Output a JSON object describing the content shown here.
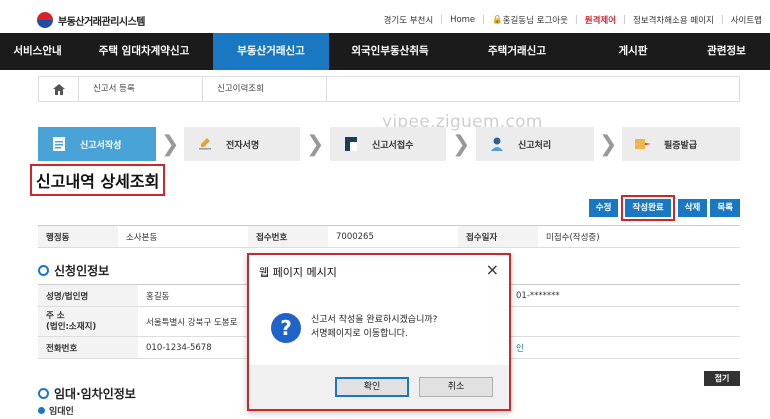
{
  "site": {
    "name": "부동산거래관리시스템"
  },
  "util_links": [
    "경기도 부천시",
    "Home",
    "홍길동님 로그아웃",
    "원격제어",
    "정보격차해소용 페이지",
    "사이트맵"
  ],
  "nav": [
    "서비스안내",
    "주택 임대차계약신고",
    "부동산거래신고",
    "외국인부동산취득",
    "주택거래신고",
    "게시판",
    "관련정보"
  ],
  "nav_active_index": 2,
  "breadcrumb": [
    "신고서 등록",
    "신고이력조회"
  ],
  "steps": [
    "신고서작성",
    "전자서명",
    "신고서접수",
    "신고처리",
    "필증발급"
  ],
  "watermark": "yipee.ziguem.com",
  "page_title": "신고내역 상세조회",
  "actions": [
    "수정",
    "작성완료",
    "삭제",
    "목록"
  ],
  "summary": {
    "labels": [
      "행정동",
      "접수번호",
      "접수일자"
    ],
    "values": [
      "소사본동",
      "7000265",
      "미접수(작성중)"
    ]
  },
  "section1": {
    "title": "신청인정보",
    "name_label": "성명/법인명",
    "name_value": "홍길동",
    "addr_label": "주 소",
    "addr_sub": "(법인:소재지)",
    "addr_value": "서울특별시 강북구 도봉로",
    "phone_label": "전화번호",
    "phone_value": "010-1234-5678",
    "id_value": "01-*******",
    "right_trailing": "인"
  },
  "section2": {
    "title": "임대·임차인정보",
    "sub": "임대인"
  },
  "fold_button": "접기",
  "dialog": {
    "title": "웹 페이지 메시지",
    "line1": "신고서 작성을 완료하시겠습니까?",
    "line2": "서명페이지로 이동합니다.",
    "ok": "확인",
    "cancel": "취소",
    "close": "×"
  },
  "colors": {
    "brand_blue": "#1a78c2",
    "nav_bg": "#1b1b1b",
    "highlight_red": "#d3232e"
  }
}
